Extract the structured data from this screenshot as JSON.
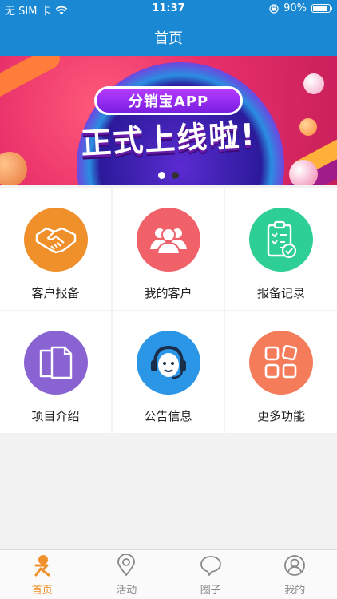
{
  "status_bar": {
    "carrier": "无 SIM 卡",
    "time": "11:37",
    "battery": "90%"
  },
  "header": {
    "title": "首页"
  },
  "banner": {
    "pill_text": "分销宝APP",
    "slogan": "正式上线啦!",
    "slide_count": 2,
    "active_slide": 1
  },
  "grid": {
    "items": [
      {
        "label": "客户报备",
        "icon": "handshake-icon",
        "color": "#f0902a"
      },
      {
        "label": "我的客户",
        "icon": "users-icon",
        "color": "#f0616a"
      },
      {
        "label": "报备记录",
        "icon": "clipboard-check-icon",
        "color": "#2ecf94"
      },
      {
        "label": "项目介绍",
        "icon": "documents-icon",
        "color": "#8a63d2"
      },
      {
        "label": "公告信息",
        "icon": "headset-agent-icon",
        "color": "#2c96e6"
      },
      {
        "label": "更多功能",
        "icon": "grid-squares-icon",
        "color": "#f57c5a"
      }
    ]
  },
  "tabbar": {
    "tabs": [
      {
        "label": "首页",
        "icon": "home-person-icon",
        "active": true
      },
      {
        "label": "活动",
        "icon": "location-pin-icon",
        "active": false
      },
      {
        "label": "圈子",
        "icon": "chat-bubble-icon",
        "active": false
      },
      {
        "label": "我的",
        "icon": "user-profile-icon",
        "active": false
      }
    ]
  },
  "colors": {
    "header": "#1a88d2",
    "accent": "#f0902a",
    "inactive": "#888888"
  }
}
